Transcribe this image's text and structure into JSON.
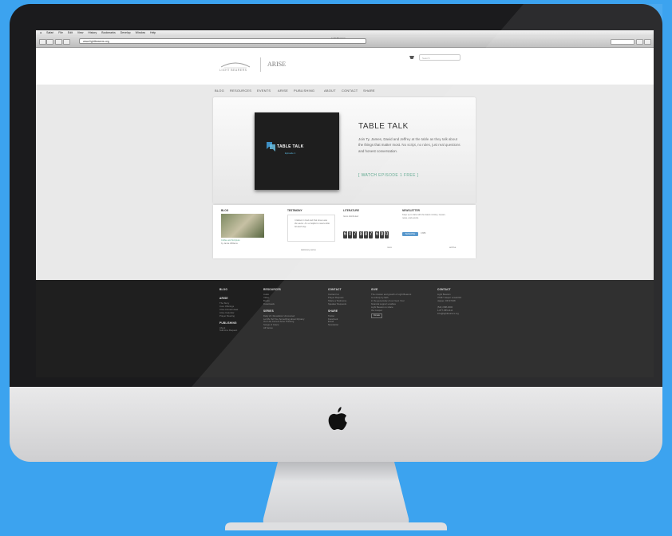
{
  "browser": {
    "menu": [
      "Safari",
      "File",
      "Edit",
      "View",
      "History",
      "Bookmarks",
      "Develop",
      "Window",
      "Help"
    ],
    "window_title": "Light Bearers",
    "url": "www.lightbearers.org"
  },
  "site": {
    "logo_text": "LIGHT BEARERS",
    "arise_text": "ARISE",
    "search_placeholder": "Search",
    "nav": [
      "BLOG",
      "RESOURCES",
      "EVENTS",
      "ARISE",
      "PUBLISHING",
      "ABOUT",
      "CONTACT",
      "SHARE"
    ]
  },
  "hero": {
    "image_title": "TABLE TALK",
    "image_subtitle": "Episode 1",
    "title": "TABLE TALK",
    "body": "Join Ty, James, David and Jeffrey at the table as they talk about the things that matter most. No script, no rules, just real questions and honest conversation.",
    "cta": "[ WATCH EPISODE 1 FREE ]"
  },
  "widgets": {
    "blog": {
      "head": "BLOG",
      "caption": "Coffee and Scripture",
      "byline": "by Jamie Williams"
    },
    "testimony": {
      "head": "TESTIMONY",
      "quote": "I believe in God and that Jesus was the savior. It's so helpful to read a little bit each day...",
      "more": "testimony series"
    },
    "literature": {
      "head": "LITERATURE",
      "label": "Items distributed",
      "digits": [
        "6",
        "0",
        "7",
        "8",
        "8",
        "7",
        "6",
        "9",
        "0"
      ],
      "link": "more"
    },
    "newsletter": {
      "head": "NEWSLETTER",
      "text": "Keep up to date with the latest ministry, impact, news, and events.",
      "button": "Subscribe",
      "count": "3,886",
      "link": "archive"
    }
  },
  "footer": {
    "cols": [
      {
        "head": "BLOG",
        "items": []
      },
      {
        "head": "ARISE",
        "items": [
          "The Story",
          "Core Offerings",
          "Arise Annual Ideas",
          "Arise Calendar",
          "Prayer Meeting"
        ]
      },
      {
        "head": "PUBLISHING",
        "items": [
          "About",
          "Submit a Request"
        ]
      },
      {
        "head": "RESOURCES",
        "items": [
          "Audio",
          "Video",
          "Books",
          "Downloads"
        ]
      },
      {
        "head": "SERIES",
        "items": [
          "Daily 21: Revelation Uncovered",
          "Let Me Tell You Something about Mystery",
          "Our Life Current Arise Thinking",
          "Songs of Grace",
          "All Series"
        ]
      },
      {
        "head": "CONTACT",
        "items": [
          "Contact Us",
          "Prayer Request",
          "Share a Testimony",
          "Speaker Requests"
        ]
      },
      {
        "head": "SHARE",
        "items": [
          "Twitter",
          "Facebook",
          "Email",
          "Newsletter"
        ]
      },
      {
        "head": "GIVE",
        "items": [
          "The mission and growth of Light Bearers is entirely by faith",
          "in the generosity of our God. Your financial support enables",
          "Light Bearers to share",
          "the Gospel."
        ],
        "button": "Donate"
      },
      {
        "head": "CONTACT",
        "items": [
          "Light Bearers",
          "37457 Jasper Lowell Rd",
          "Jasper, OR 97438",
          "",
          "(541) 988-3000",
          "1-877-585-1111",
          "info@lightbearers.org"
        ]
      }
    ]
  },
  "colors": {
    "background": "#3ca3ef",
    "footer": "#1f1f1f",
    "cta": "#5ba68c"
  }
}
